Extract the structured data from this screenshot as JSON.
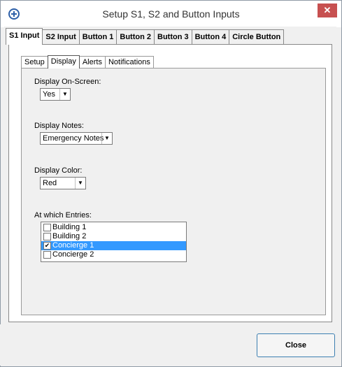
{
  "window": {
    "title": "Setup S1, S2 and Button Inputs",
    "close_glyph": "✕"
  },
  "tabs": [
    {
      "label": "S1 Input",
      "active": true
    },
    {
      "label": "S2 Input",
      "active": false
    },
    {
      "label": "Button 1",
      "active": false
    },
    {
      "label": "Button 2",
      "active": false
    },
    {
      "label": "Button 3",
      "active": false
    },
    {
      "label": "Button 4",
      "active": false
    },
    {
      "label": "Circle Button",
      "active": false
    }
  ],
  "subtabs": [
    {
      "label": "Setup",
      "active": false
    },
    {
      "label": "Display",
      "active": true
    },
    {
      "label": "Alerts",
      "active": false
    },
    {
      "label": "Notifications",
      "active": false
    }
  ],
  "display_on_screen": {
    "label": "Display On-Screen:",
    "value": "Yes"
  },
  "display_notes": {
    "label": "Display Notes:",
    "value": "Emergency Notes"
  },
  "display_color": {
    "label": "Display Color:",
    "value": "Red"
  },
  "entries": {
    "label": "At which Entries:",
    "items": [
      {
        "label": "Building 1",
        "checked": false,
        "selected": false
      },
      {
        "label": "Building 2",
        "checked": false,
        "selected": false
      },
      {
        "label": "Concierge 1",
        "checked": true,
        "selected": true
      },
      {
        "label": "Concierge 2",
        "checked": false,
        "selected": false
      }
    ]
  },
  "footer": {
    "close_label": "Close"
  },
  "icons": {
    "app": "app-logo-icon",
    "dropdown": "chevron-down-icon",
    "check": "checkmark-icon"
  },
  "colors": {
    "selection": "#3399ff",
    "close_titlebar": "#c75050"
  }
}
